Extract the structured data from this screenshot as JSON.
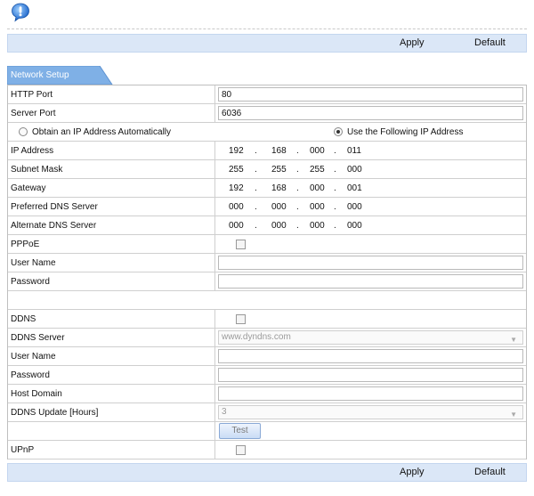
{
  "toolbar": {
    "apply_label": "Apply",
    "default_label": "Default"
  },
  "tab": {
    "label": "Network Setup"
  },
  "http_port": {
    "label": "HTTP Port",
    "value": "80"
  },
  "server_port": {
    "label": "Server Port",
    "value": "6036"
  },
  "ip_mode": {
    "auto_label": "Obtain an IP Address Automatically",
    "manual_label": "Use the Following IP Address",
    "selected": "manual"
  },
  "ip_address": {
    "label": "IP Address",
    "octets": [
      "192",
      "168",
      "000",
      "011"
    ]
  },
  "subnet_mask": {
    "label": "Subnet Mask",
    "octets": [
      "255",
      "255",
      "255",
      "000"
    ]
  },
  "gateway": {
    "label": "Gateway",
    "octets": [
      "192",
      "168",
      "000",
      "001"
    ]
  },
  "preferred_dns": {
    "label": "Preferred DNS Server",
    "octets": [
      "000",
      "000",
      "000",
      "000"
    ]
  },
  "alternate_dns": {
    "label": "Alternate DNS Server",
    "octets": [
      "000",
      "000",
      "000",
      "000"
    ]
  },
  "separator": ".",
  "pppoe": {
    "label": "PPPoE",
    "checked": false,
    "user_label": "User Name",
    "user_value": "",
    "password_label": "Password",
    "password_value": ""
  },
  "ddns": {
    "label": "DDNS",
    "checked": false,
    "server_label": "DDNS Server",
    "server_value": "www.dyndns.com",
    "user_label": "User Name",
    "user_value": "",
    "password_label": "Password",
    "password_value": "",
    "host_label": "Host Domain",
    "host_value": "",
    "update_label": "DDNS Update [Hours]",
    "update_value": "3",
    "test_label": "Test"
  },
  "upnp": {
    "label": "UPnP",
    "checked": false
  }
}
